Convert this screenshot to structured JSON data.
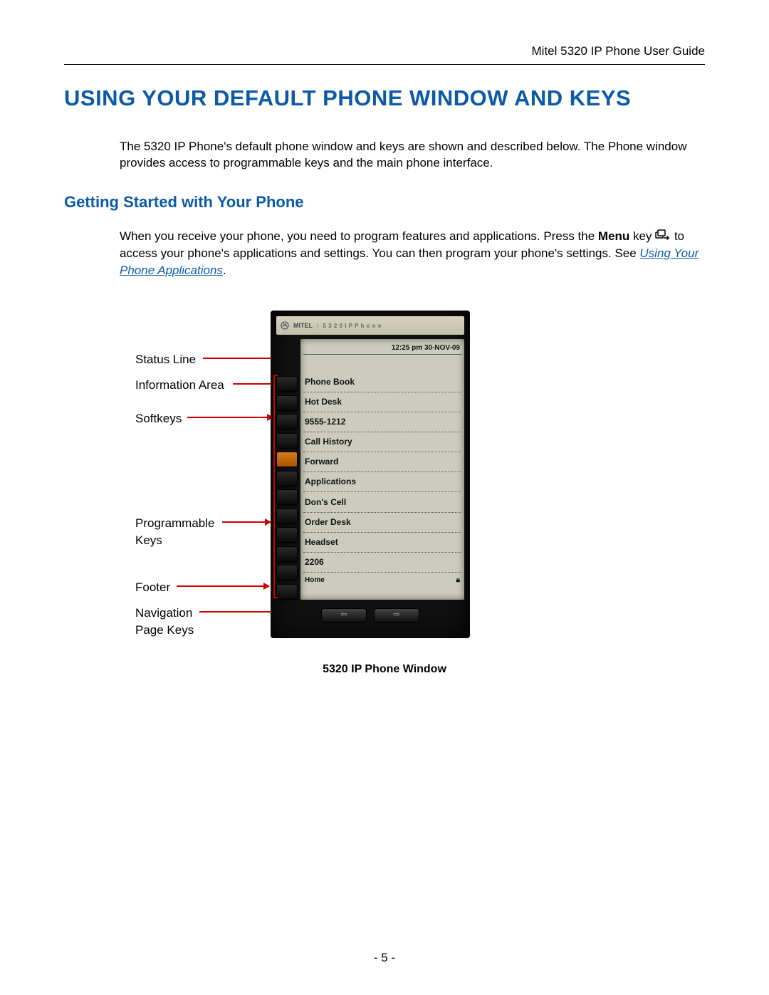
{
  "header": {
    "doc_title": "Mitel 5320 IP Phone User Guide"
  },
  "h1": "USING YOUR DEFAULT PHONE WINDOW AND KEYS",
  "intro": "The 5320 IP Phone's default phone window and keys are shown and described below. The Phone window provides access to programmable keys and the main phone interface.",
  "h2": "Getting Started with Your Phone",
  "para2_a": "When you receive your phone, you need to program features and applications. Press the ",
  "para2_menu": "Menu",
  "para2_b": " key ",
  "para2_c": " to access your phone's applications and settings. You can then program your phone's settings. See ",
  "para2_link": "Using Your Phone Applications",
  "para2_d": ".",
  "callouts": {
    "status_line": "Status Line",
    "information_area": "Information Area",
    "softkeys": "Softkeys",
    "programmable_keys_l1": "Programmable",
    "programmable_keys_l2": "Keys",
    "footer": "Footer",
    "nav_l1": "Navigation",
    "nav_l2": "Page Keys"
  },
  "phone": {
    "brand": "MITEL",
    "model": "5 3 2 0  I P  P h o n e",
    "status_line": "12:25 pm  30-NOV-09",
    "rows": {
      "r0": "Phone Book",
      "r1": "Hot Desk",
      "r2": "9555-1212",
      "r3": "Call History",
      "r4": "Forward",
      "r5": "Applications",
      "r6": "Don's Cell",
      "r7": "Order Desk",
      "r8": "Headset",
      "r9": "2206"
    },
    "footer_left": "Home",
    "nav_left": "⇦",
    "nav_right": "⇨"
  },
  "caption": "5320 IP Phone Window",
  "page_number": "- 5 -"
}
